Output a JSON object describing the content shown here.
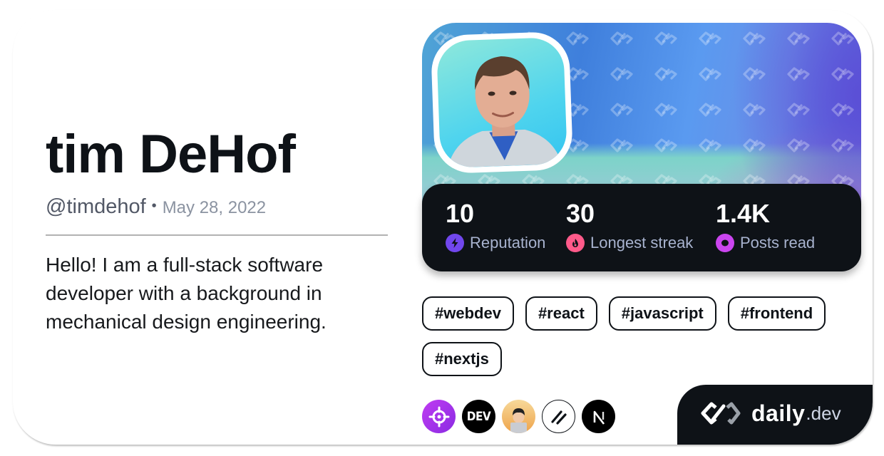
{
  "profile": {
    "name": "tim DeHof",
    "handle": "@timdehof",
    "separator": "•",
    "joined_date": "May 28, 2022",
    "bio": "Hello! I am a full-stack software developer with a background in mechanical design engineering."
  },
  "stats": [
    {
      "value": "10",
      "label": "Reputation",
      "icon": "lightning-icon",
      "color": "#7147ed"
    },
    {
      "value": "30",
      "label": "Longest streak",
      "icon": "flame-icon",
      "color": "#ff5a8a"
    },
    {
      "value": "1.4K",
      "label": "Posts read",
      "icon": "ring-icon",
      "color": "#cb45ef"
    }
  ],
  "tags": [
    "#webdev",
    "#react",
    "#javascript",
    "#frontend",
    "#nextjs"
  ],
  "sources": [
    {
      "name": "crosshair-source",
      "icon": "crosshair-icon",
      "color": "#a83af0"
    },
    {
      "name": "dev-to-source",
      "label": "DEV",
      "icon": "dev-icon",
      "color": "#000000"
    },
    {
      "name": "dessquad-source",
      "icon": "memoji-avatar-icon",
      "color": "#f2a94a"
    },
    {
      "name": "slash-source",
      "icon": "double-slash-icon",
      "color": "#ffffff"
    },
    {
      "name": "nextjs-source",
      "icon": "nextjs-icon",
      "color": "#000000"
    }
  ],
  "brand": {
    "primary": "daily",
    "secondary": ".dev"
  },
  "colors": {
    "text_primary": "#0e1217",
    "stats_background": "#0e1217",
    "stat_label": "#a8b3cf"
  }
}
